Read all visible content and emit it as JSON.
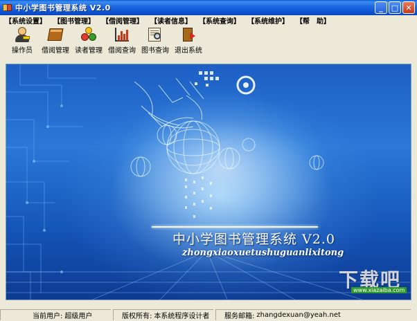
{
  "window": {
    "title": "中小学图书管理系统 V2.0",
    "icon": "books-icon",
    "controls": [
      "minimize",
      "maximize",
      "close"
    ]
  },
  "menu": [
    "【系统设置】",
    "【图书管理】",
    "【借阅管理】",
    "【读者信息】",
    "【系统查询】",
    "【系统维护】",
    "【帮　助】"
  ],
  "toolbar": [
    {
      "label": "操作员",
      "icon": "operator-icon"
    },
    {
      "label": "借阅管理",
      "icon": "book-icon"
    },
    {
      "label": "读者管理",
      "icon": "readers-icon"
    },
    {
      "label": "借阅查询",
      "icon": "chart-icon"
    },
    {
      "label": "图书查询",
      "icon": "book-search-icon"
    },
    {
      "label": "退出系统",
      "icon": "exit-icon"
    }
  ],
  "splash": {
    "title": "中小学图书管理系统 V2.0",
    "pinyin": "zhongxiaoxuetushuguanlixitong"
  },
  "status": {
    "user_label": "当前用户:",
    "user_value": "超级用户",
    "copyright_label": "版权所有:",
    "copyright_value": "本系统程序设计者",
    "email_label": "服务邮箱:",
    "email_value": "zhangdexuan@yeah.net"
  },
  "watermark": {
    "text": "下载吧",
    "badge": "www.xiazaiba.com"
  },
  "colors": {
    "titlebar": "#0b4fcf",
    "window_bg": "#ece9d8",
    "splash_bg": "#1e5fc4"
  }
}
